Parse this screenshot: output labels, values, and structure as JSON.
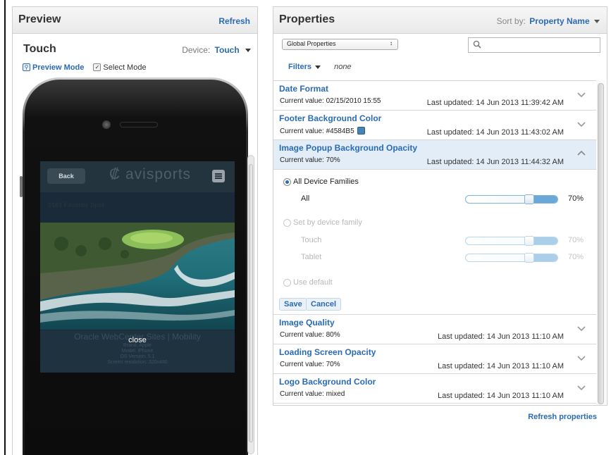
{
  "preview": {
    "title": "Preview",
    "refresh_label": "Refresh",
    "device_title": "Touch",
    "device_label": "Device:",
    "device_value": "Touch",
    "preview_mode_label": "Preview Mode",
    "select_mode_label": "Select Mode",
    "app": {
      "back_label": "Back",
      "logo_text": "avisports",
      "spot_title": "0163 Favorite Spot",
      "footer_title": "Oracle WebCenter Sites | Mobility",
      "close_label": "close",
      "brand": "Brand: Apple",
      "model": "Model: iPhone",
      "os_version": "OS Version: 5.1",
      "screen_resolution": "Screen resolution: 320x480"
    }
  },
  "properties": {
    "title": "Properties",
    "sort_label": "Sort by:",
    "sort_value": "Property Name",
    "scope_value": "Global Properties",
    "search_placeholder": "",
    "filters_label": "Filters",
    "filters_value": "none",
    "items": [
      {
        "name": "Date Format",
        "value": "Current value: 02/15/2010 15:55",
        "updated": "Last updated: 14 Jun 2013 11:39:42 AM"
      },
      {
        "name": "Footer Background Color",
        "value": "Current value: #4584B5",
        "updated": "Last updated: 14 Jun 2013 11:43:02 AM",
        "swatch": "#4584B5"
      },
      {
        "name": "Image Popup Background Opacity",
        "value": "Current value: 70%",
        "updated": "Last updated: 14 Jun 2013 11:44:32 AM"
      },
      {
        "name": "Image Quality",
        "value": "Current value: 80%",
        "updated": "Last updated: 14 Jun 2013 11:10 AM"
      },
      {
        "name": "Loading Screen Opacity",
        "value": "Current value: 70%",
        "updated": "Last updated: 14 Jun 2013 11:10 AM"
      },
      {
        "name": "Logo Background Color",
        "value": "Current value: mixed",
        "updated": "Last updated: 14 Jun 2013 11:10 AM"
      }
    ],
    "editor": {
      "all_families_label": "All Device Families",
      "all_label": "All",
      "all_percent": "70%",
      "all_level": 70,
      "by_family_label": "Set by device family",
      "touch_label": "Touch",
      "touch_percent": "70%",
      "touch_level": 70,
      "tablet_label": "Tablet",
      "tablet_percent": "70%",
      "tablet_level": 70,
      "default_label": "Use default",
      "save_label": "Save",
      "cancel_label": "Cancel"
    },
    "refresh_properties_label": "Refresh properties"
  },
  "colors": {
    "accent": "#2a6bb5",
    "swatch": "#4584B5",
    "slider_fill": "#6aa8d8"
  },
  "icons": {
    "search": "search-icon",
    "chevron_down": "chevron-down-icon",
    "chevron_up": "chevron-up-icon"
  }
}
